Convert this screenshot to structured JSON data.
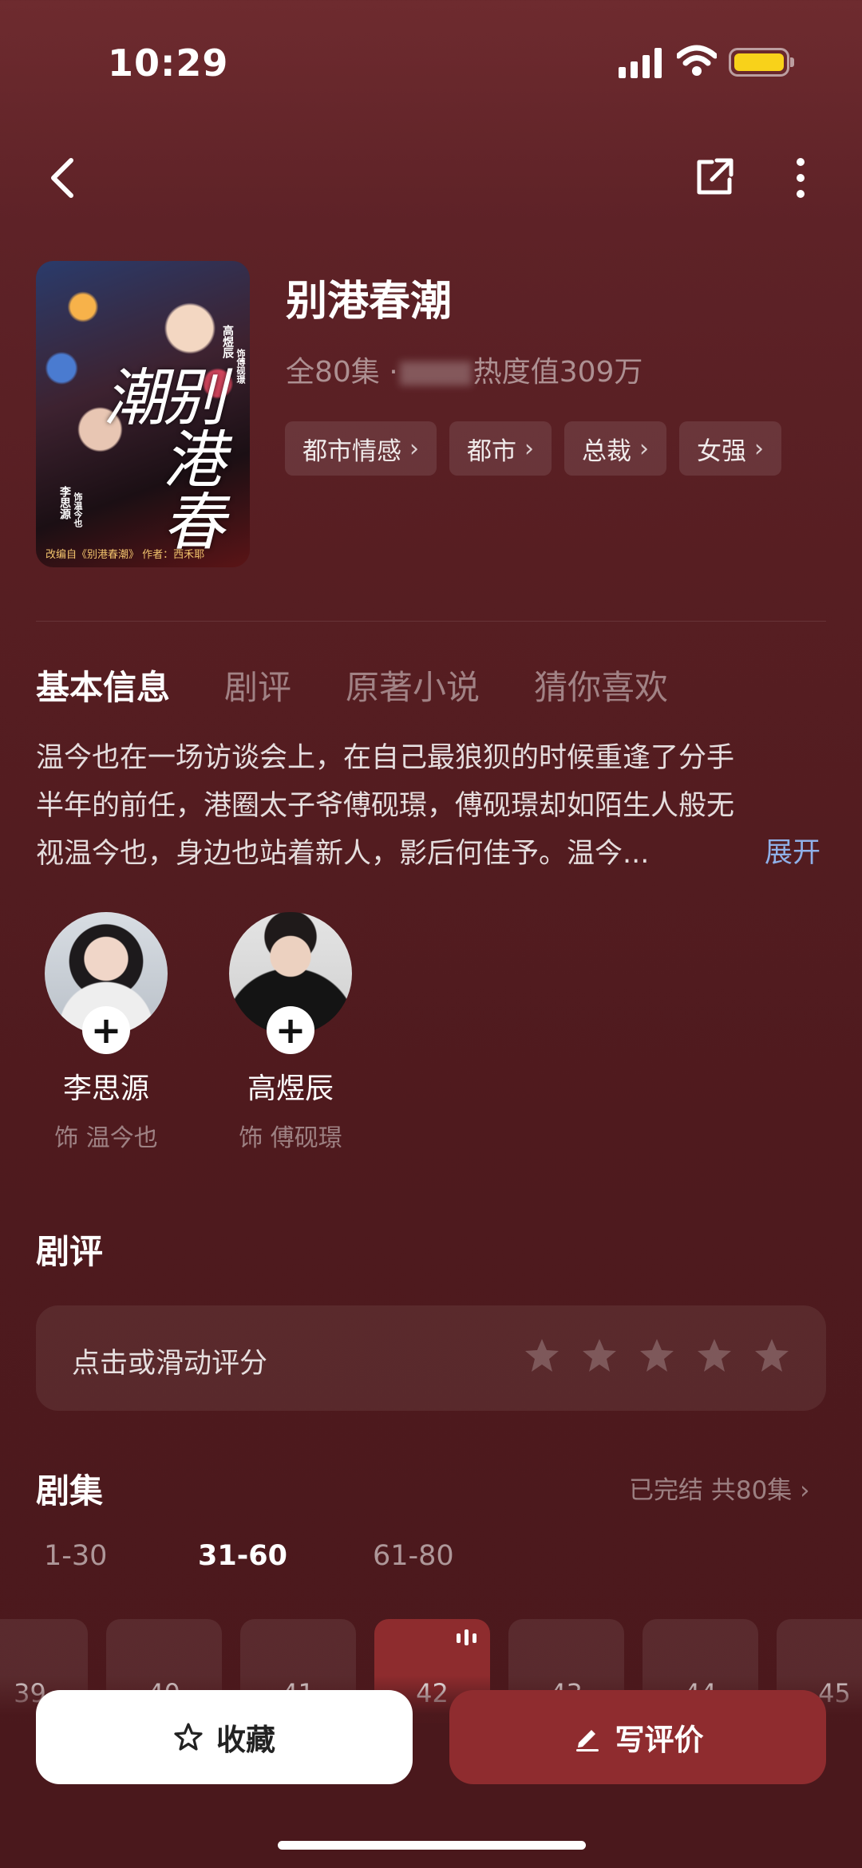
{
  "status_bar": {
    "time": "10:29"
  },
  "colors": {
    "accent": "#8f2c2f",
    "link": "#8fb0e8",
    "battery": "#f8d21a"
  },
  "poster": {
    "title_art": "别港春潮",
    "actor1": "高煜辰",
    "actor1_role": "饰傅砚璟",
    "actor2": "李思源",
    "actor2_role": "饰温今也",
    "credit": "改编自《别港春潮》 作者：西禾耶"
  },
  "show": {
    "title": "别港春潮",
    "episodes_text": "全80集 ·",
    "heat_text": "热度值309万",
    "tags": [
      {
        "label": "都市情感",
        "icon": "chevron-right-icon"
      },
      {
        "label": "都市",
        "icon": "chevron-right-icon"
      },
      {
        "label": "总裁",
        "icon": "chevron-right-icon"
      },
      {
        "label": "女强",
        "icon": "chevron-right-icon"
      }
    ]
  },
  "tabs": [
    "基本信息",
    "剧评",
    "原著小说",
    "猜你喜欢"
  ],
  "synopsis": {
    "lines": [
      "温今也在一场访谈会上，在自己最狼狈的时候重逢了分手",
      "半年的前任，港圈太子爷傅砚璟，傅砚璟却如陌生人般无",
      "视温今也，身边也站着新人，影后何佳予。温今..."
    ],
    "expand": "展开"
  },
  "cast": [
    {
      "name": "李思源",
      "role": "饰 温今也",
      "follow": "+"
    },
    {
      "name": "高煜辰",
      "role": "饰 傅砚璟",
      "follow": "+"
    }
  ],
  "review": {
    "title": "剧评",
    "prompt": "点击或滑动评分",
    "star_count": 5
  },
  "episodes": {
    "title": "剧集",
    "status": "已完结 共80集",
    "ranges": [
      "1-30",
      "31-60",
      "61-80"
    ],
    "active_range": "31-60",
    "items": [
      "39",
      "40",
      "41",
      "42",
      "43",
      "44",
      "45"
    ],
    "playing": "42"
  },
  "actions": {
    "favorite": "收藏",
    "write_review": "写评价"
  }
}
